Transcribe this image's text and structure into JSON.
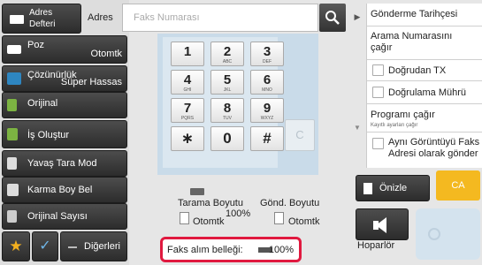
{
  "top": {
    "address_book_label": "Adres\nDefteri",
    "address_label": "Adres",
    "fax_number_placeholder": "Faks Numarası"
  },
  "sidebar": {
    "items": [
      {
        "label": "Poz",
        "value": "Otomtk",
        "icon": "exposure-icon"
      },
      {
        "label": "Çözünürlük",
        "value": "Süper Hassas",
        "icon": "resolution-icon"
      },
      {
        "label": "Orijinal",
        "value": "",
        "icon": "original-icon"
      },
      {
        "label": "İş Oluştur",
        "value": "",
        "icon": "job-build-icon"
      },
      {
        "label": "Yavaş Tara Mod",
        "value": "",
        "icon": "slow-scan-icon"
      },
      {
        "label": "Karma Boy Bel",
        "value": "",
        "icon": "mixed-size-icon"
      },
      {
        "label": "Orijinal Sayısı",
        "value": "",
        "icon": "original-count-icon"
      }
    ],
    "other_label": "Diğerleri"
  },
  "keypad": {
    "keys": [
      {
        "main": "1",
        "sub": ""
      },
      {
        "main": "2",
        "sub": "ABC"
      },
      {
        "main": "3",
        "sub": "DEF"
      },
      {
        "main": "4",
        "sub": "GHI"
      },
      {
        "main": "5",
        "sub": "JKL"
      },
      {
        "main": "6",
        "sub": "MNO"
      },
      {
        "main": "7",
        "sub": "PQRS"
      },
      {
        "main": "8",
        "sub": "TUV"
      },
      {
        "main": "9",
        "sub": "WXYZ"
      },
      {
        "main": "∗",
        "sub": ""
      },
      {
        "main": "0",
        "sub": ""
      },
      {
        "main": "#",
        "sub": ""
      }
    ],
    "clear_label": "C"
  },
  "scan": {
    "scan_size_label": "Tarama Boyutu",
    "scan_size_value": "Otomtk",
    "ratio": "100%",
    "send_size_label": "Gönd. Boyutu",
    "send_size_value": "Otomtk"
  },
  "memory": {
    "label": "Faks alım belleği:",
    "value": "100%",
    "fill_fraction": 1.0
  },
  "right_panel": {
    "send_history": "Gönderme Tarihçesi",
    "call_number": "Arama Numarasını\nçağır",
    "direct_tx": "Doğrudan TX",
    "verify_stamp": "Doğrulama Mührü",
    "program_call": "Programı çağır",
    "program_call_sub": "Kayıtlı ayarları çağır",
    "same_fax": "Aynı Görüntüyü Faks\nAdresi olarak gönder"
  },
  "actions": {
    "preview_label": "Önizle",
    "ca_label": "CA",
    "speaker_label": "Hoparlör",
    "start_label": ""
  },
  "colors": {
    "accent_red": "#e0193f",
    "ca_yellow": "#f4b920",
    "star_yellow": "#f3b01f",
    "check_blue": "#6fb6e8"
  }
}
